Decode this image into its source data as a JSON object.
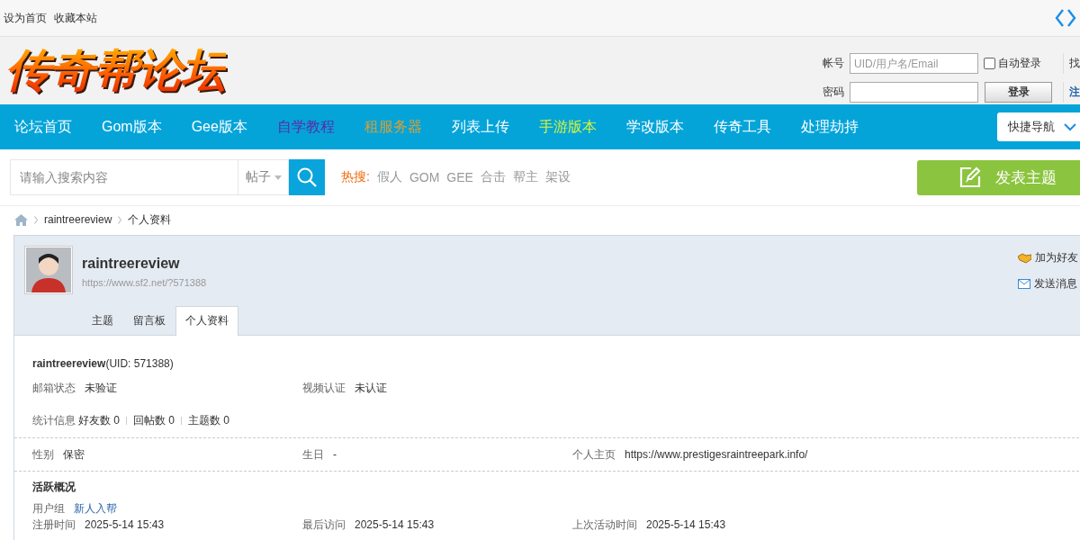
{
  "top_links": [
    "设为首页",
    "收藏本站"
  ],
  "logo": "传奇帮论坛",
  "login": {
    "account_label": "帐号",
    "account_placeholder": "UID/用户名/Email",
    "auto_login": {
      "label": "自动登录",
      "checked": false
    },
    "password_label": "密码",
    "login_button": "登录",
    "find_link": "找",
    "register_link": "注"
  },
  "nav": [
    {
      "label": "论坛首页",
      "color": "#ffffff"
    },
    {
      "label": "Gom版本",
      "color": "#ffffff"
    },
    {
      "label": "Gee版本",
      "color": "#ffffff"
    },
    {
      "label": "自学教程",
      "color": "#5a2aa8"
    },
    {
      "label": "租服务器",
      "color": "#d9a032"
    },
    {
      "label": "列表上传",
      "color": "#ffffff"
    },
    {
      "label": "手游版本",
      "color": "#d8f53a"
    },
    {
      "label": "学改版本",
      "color": "#ffffff"
    },
    {
      "label": "传奇工具",
      "color": "#ffffff"
    },
    {
      "label": "处理劫持",
      "color": "#ffffff"
    }
  ],
  "quick_nav": "快捷导航",
  "search": {
    "placeholder": "请输入搜索内容",
    "scope": "帖子"
  },
  "hot": {
    "label": "热搜:",
    "terms": [
      "假人",
      "GOM",
      "GEE",
      "合击",
      "帮主",
      "架设"
    ]
  },
  "post_button": "发表主题",
  "breadcrumb": [
    "raintreereview",
    "个人资料"
  ],
  "profile": {
    "username": "raintreereview",
    "url": "https://www.sf2.net/?571388",
    "actions": [
      {
        "kind": "friend",
        "label": "加为好友"
      },
      {
        "kind": "message",
        "label": "发送消息"
      }
    ],
    "tabs": [
      {
        "label": "主题",
        "selected": false
      },
      {
        "label": "留言板",
        "selected": false
      },
      {
        "label": "个人资料",
        "selected": true
      }
    ]
  },
  "details": [
    {
      "kind": "title",
      "text": "**raintreereview**(UID: 571388)"
    },
    {
      "kind": "fields",
      "separated": false,
      "fields": [
        {
          "label": "邮箱状态",
          "value": "未验证",
          "link": false
        },
        {
          "label": "视频认证",
          "value": "未认证",
          "link": false
        }
      ]
    },
    {
      "kind": "stats",
      "label": "统计信息",
      "items": [
        "好友数 0",
        "回帖数 0",
        "主题数 0"
      ]
    },
    {
      "kind": "fields",
      "separated": true,
      "fields": [
        {
          "label": "性别",
          "value": "保密",
          "link": false
        },
        {
          "label": "生日",
          "value": "-",
          "link": false
        },
        {
          "label": "个人主页",
          "value": "https://www.prestigesraintreepark.info/",
          "link": false
        }
      ]
    },
    {
      "kind": "heading",
      "text": "活跃概况"
    },
    {
      "kind": "fields",
      "separated": false,
      "fields": [
        {
          "label": "用户组",
          "value": "新人入帮",
          "link": true
        }
      ]
    },
    {
      "kind": "fields",
      "separated": false,
      "fields": [
        {
          "label": "注册时间",
          "value": "2025-5-14 15:43",
          "link": false
        },
        {
          "label": "最后访问",
          "value": "2025-5-14 15:43",
          "link": false
        },
        {
          "label": "上次活动时间",
          "value": "2025-5-14 15:43",
          "link": false
        }
      ]
    }
  ]
}
